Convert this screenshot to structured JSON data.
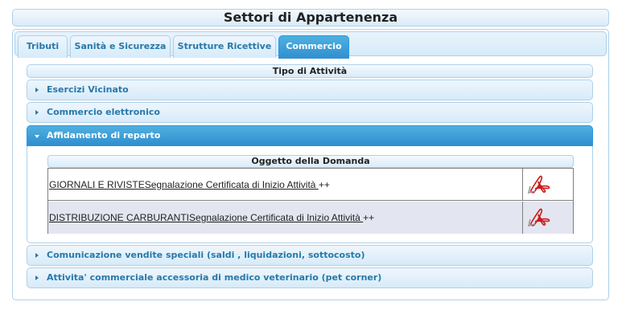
{
  "page_title": "Settori di Appartenenza",
  "tabs": [
    {
      "label": "Tributi"
    },
    {
      "label": "Sanità e Sicurezza"
    },
    {
      "label": "Strutture Ricettive"
    },
    {
      "label": "Commercio"
    }
  ],
  "active_tab": "Commercio",
  "tipo_header": "Tipo di Attività",
  "accordion": [
    {
      "label": "Esercizi Vicinato"
    },
    {
      "label": "Commercio elettronico"
    },
    {
      "label": "Affidamento di reparto"
    },
    {
      "label": "Comunicazione vendite speciali (saldi , liquidazioni, sottocosto)"
    },
    {
      "label": "Attivita' commerciale accessoria di medico veterinario (pet corner)"
    }
  ],
  "expanded_section": "Affidamento di reparto",
  "oggetto_header": "Oggetto della Domanda",
  "documents": [
    {
      "link_text": "GIORNALI E RIVISTESegnalazione Certificata di Inizio Attività ",
      "suffix": "++",
      "icon": "pdf-icon"
    },
    {
      "link_text": "DISTRIBUZIONE CARBURANTISegnalazione Certificata di Inizio Attività ",
      "suffix": "++",
      "icon": "pdf-icon"
    }
  ],
  "colors": {
    "accent": "#2f8fcf",
    "tab_text": "#2779aa",
    "border": "#aed0ea",
    "pdf_red": "#cc1a1a"
  }
}
